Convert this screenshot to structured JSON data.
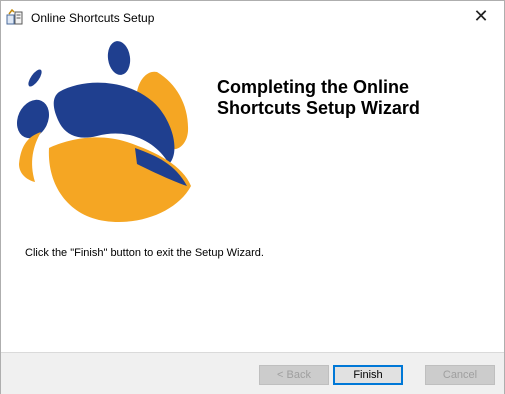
{
  "window": {
    "title": "Online Shortcuts Setup",
    "app_icon": "setup-installer-icon",
    "close_glyph": "✕"
  },
  "wizard": {
    "heading_line1": "Completing the Online",
    "heading_line2": "Shortcuts Setup Wizard",
    "message": "Click the \"Finish\" button to exit the Setup Wizard.",
    "logo": "abstract-blue-orange-figures-logo"
  },
  "buttons": {
    "back": "< Back",
    "finish": "Finish",
    "cancel": "Cancel"
  },
  "colors": {
    "logo_blue": "#1f3f8f",
    "logo_orange": "#f5a623"
  }
}
